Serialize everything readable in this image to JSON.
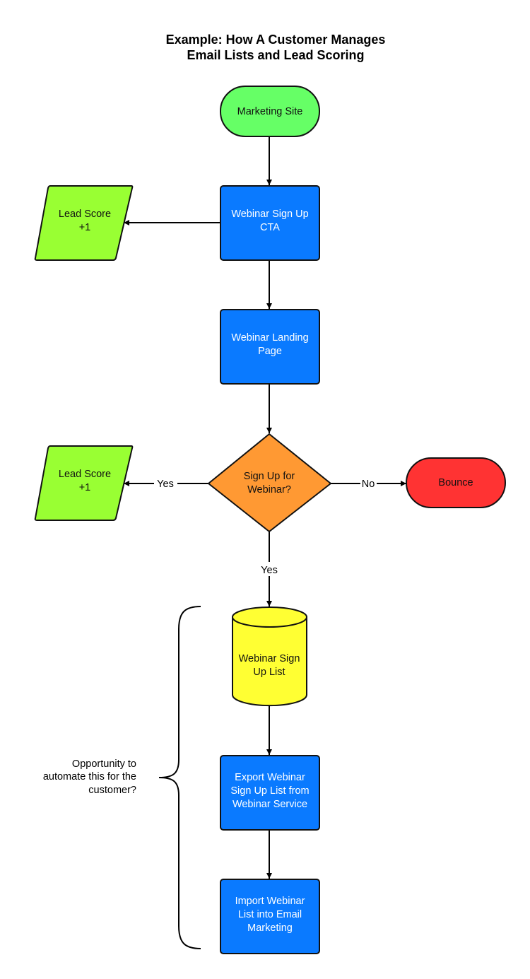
{
  "title": {
    "line1": "Example: How A Customer Manages",
    "line2": "Email Lists and Lead Scoring"
  },
  "colors": {
    "start": "#66ff66",
    "process": "#0a7aff",
    "lead_score": "#99ff33",
    "decision": "#ff9933",
    "bounce": "#ff3333",
    "database": "#ffff33"
  },
  "nodes": {
    "marketing_site": {
      "type": "terminator",
      "lines": [
        "Marketing Site"
      ]
    },
    "webinar_cta": {
      "type": "process",
      "lines": [
        "Webinar Sign Up",
        "CTA"
      ]
    },
    "lead_score_1": {
      "type": "data",
      "lines": [
        "Lead Score",
        "+1"
      ]
    },
    "landing_page": {
      "type": "process",
      "lines": [
        "Webinar Landing",
        "Page"
      ]
    },
    "decision": {
      "type": "decision",
      "lines": [
        "Sign Up for",
        "Webinar?"
      ]
    },
    "lead_score_2": {
      "type": "data",
      "lines": [
        "Lead Score",
        "+1"
      ]
    },
    "bounce": {
      "type": "terminator",
      "lines": [
        "Bounce"
      ]
    },
    "signup_list": {
      "type": "database",
      "lines": [
        "Webinar Sign",
        "Up List"
      ]
    },
    "export": {
      "type": "process",
      "lines": [
        "Export Webinar",
        "Sign Up List from",
        "Webinar Service"
      ]
    },
    "import": {
      "type": "process",
      "lines": [
        "Import Webinar",
        "List into Email",
        "Marketing"
      ]
    }
  },
  "edges": {
    "yes_left": "Yes",
    "no_right": "No",
    "yes_down": "Yes"
  },
  "annotation": {
    "lines": [
      "Opportunity to",
      "automate this for the",
      "customer?"
    ]
  }
}
